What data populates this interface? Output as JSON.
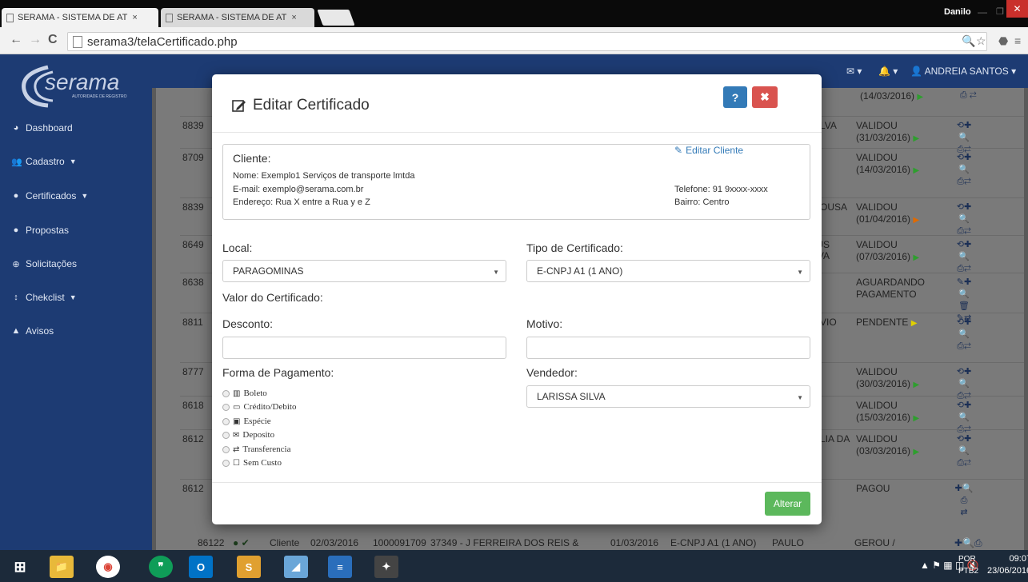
{
  "browser": {
    "tabs": [
      {
        "title": "SERAMA - SISTEMA DE AT"
      },
      {
        "title": "SERAMA - SISTEMA DE AT"
      }
    ],
    "tab_close": "×",
    "window_user": "Danilo",
    "url": "serama3/telaCertificado.php"
  },
  "header": {
    "logo_text": "serama",
    "logo_sub": "AUTORIDADE DE REGISTRO",
    "user_name": "ANDREIA SANTOS"
  },
  "sidebar": {
    "items": [
      {
        "label": "Dashboard",
        "icon": "dashboard-icon"
      },
      {
        "label": "Cadastro",
        "icon": "users-icon",
        "caret": "v"
      },
      {
        "label": "Certificados",
        "icon": "circle-icon",
        "caret": "v"
      },
      {
        "label": "Propostas",
        "icon": "circle-icon"
      },
      {
        "label": "Solicitações",
        "icon": "lifebuoy-icon"
      },
      {
        "label": "Chekclist",
        "icon": "bars-icon",
        "caret": "▾"
      },
      {
        "label": "Avisos",
        "icon": "warning-icon"
      }
    ]
  },
  "background_table": {
    "rows": [
      {
        "id": "8839",
        "name": "LVA",
        "status": "VALIDOU",
        "date": "(31/03/2016)"
      },
      {
        "id": "8709",
        "name": "",
        "status": "VALIDOU",
        "date": "(14/03/2016)"
      },
      {
        "id": "8839",
        "name": "OUSA",
        "status": "VALIDOU",
        "date": "(01/04/2016)"
      },
      {
        "id": "8649",
        "name": "ESUS SILVA",
        "status": "VALIDOU",
        "date": "(07/03/2016)"
      },
      {
        "id": "8638",
        "name": "",
        "status": "AGUARDANDO",
        "date": "PAGAMENTO"
      },
      {
        "id": "8811",
        "name": "VIO",
        "status": "PENDENTE",
        "date": ""
      },
      {
        "id": "8777",
        "name": "",
        "status": "VALIDOU",
        "date": "(30/03/2016)"
      },
      {
        "id": "8618",
        "name": "",
        "status": "VALIDOU",
        "date": "(15/03/2016)"
      },
      {
        "id": "8612",
        "name": "LIA DA",
        "status": "VALIDOU",
        "date": "(03/03/2016)"
      },
      {
        "id": "8612",
        "name": "",
        "status": "PAGOU",
        "date": ""
      }
    ],
    "top_partial_date": "(14/03/2016)",
    "last_row": {
      "id": "86122",
      "type": "Cliente",
      "date1": "02/03/2016",
      "num": "1000091709",
      "company": "37349 - J FERREIRA DOS REIS &",
      "date2": "01/03/2016",
      "cert": "E-CNPJ A1 (1 ANO)",
      "seller": "PAULO",
      "status": "GEROU /"
    }
  },
  "modal": {
    "title": "Editar Certificado",
    "help_label": "?",
    "close_label": "✖",
    "client": {
      "label": "Cliente:",
      "edit_link": "Editar Cliente",
      "nome": "Nome: Exemplo1 Serviços de transporte lmtda",
      "email": "E-mail: exemplo@serama.com.br",
      "endereco": "Endereço: Rua X entre a Rua y e Z",
      "telefone": "Telefone: 91 9xxxx-xxxx",
      "bairro": "Bairro: Centro"
    },
    "local": {
      "label": "Local:",
      "value": "PARAGOMINAS"
    },
    "tipo": {
      "label": "Tipo de Certificado:",
      "value": "E-CNPJ A1 (1 ANO)"
    },
    "valor": {
      "label": "Valor do Certificado:"
    },
    "desconto": {
      "label": "Desconto:",
      "value": ""
    },
    "motivo": {
      "label": "Motivo:",
      "value": ""
    },
    "pagamento": {
      "label": "Forma de Pagamento:",
      "options": [
        {
          "label": "Boleto",
          "icon": "barcode-icon"
        },
        {
          "label": "Crédito/Debito",
          "icon": "credit-card-icon"
        },
        {
          "label": "Espécie",
          "icon": "money-icon"
        },
        {
          "label": "Deposito",
          "icon": "envelope-icon"
        },
        {
          "label": "Transferencia",
          "icon": "transfer-icon"
        },
        {
          "label": "Sem Custo",
          "icon": "square-icon"
        }
      ]
    },
    "vendedor": {
      "label": "Vendedor:",
      "value": "LARISSA SILVA"
    },
    "submit_label": "Alterar"
  },
  "taskbar": {
    "lang1": "POR",
    "lang2": "PTB2",
    "time": "09:07",
    "date": "23/06/2016"
  },
  "colors": {
    "sidebar": "#1d3b73",
    "primary": "#337ab7",
    "danger": "#d9534f",
    "success": "#5cb85c",
    "flag_green": "#2e9e2e",
    "flag_yellow": "#e0d000",
    "flag_orange": "#e06a00"
  }
}
